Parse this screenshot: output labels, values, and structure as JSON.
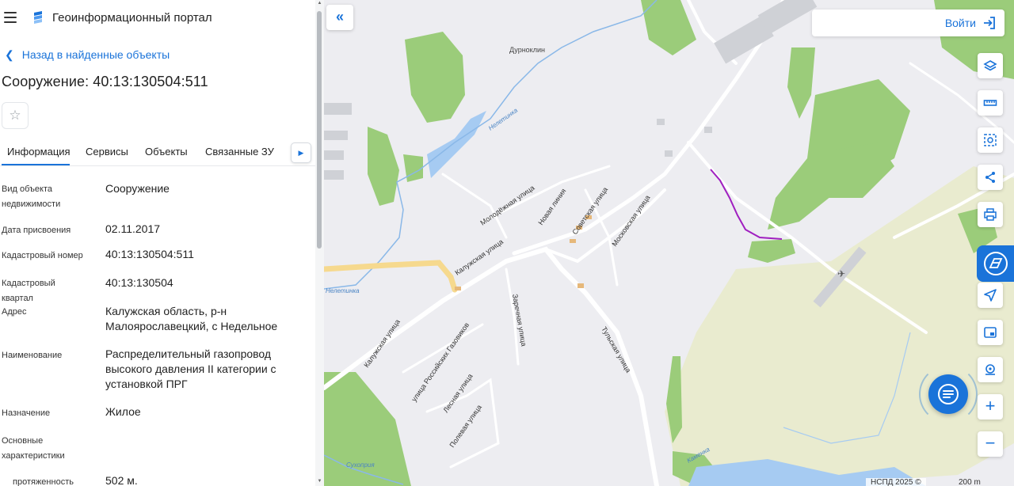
{
  "app": {
    "title": "Геоинформационный портал"
  },
  "nav": {
    "back_label": "Назад в найденные объекты"
  },
  "object": {
    "title": "Сооружение: 40:13:130504:511"
  },
  "tabs": [
    {
      "label": "Информация",
      "active": true
    },
    {
      "label": "Сервисы"
    },
    {
      "label": "Объекты"
    },
    {
      "label": "Связанные ЗУ"
    }
  ],
  "details": [
    {
      "label": "Вид объекта недвижимости",
      "value": "Сооружение"
    },
    {
      "label": "Дата присвоения",
      "value": "02.11.2017"
    },
    {
      "label": "Кадастровый номер",
      "value": "40:13:130504:511"
    },
    {
      "label": "Кадастровый квартал",
      "value": "40:13:130504"
    },
    {
      "label": "Адрес",
      "value": "Калужская область, р-н Малоярославецкий, с Недельное"
    },
    {
      "label": "Наименование",
      "value": "Распределительный газопровод высокого давления II категории с установкой ПРГ"
    },
    {
      "label": "Назначение",
      "value": "Жилое"
    },
    {
      "label": "Основные характеристики",
      "value": ""
    },
    {
      "label": "протяженность",
      "value": "502 м."
    }
  ],
  "map": {
    "login_label": "Войти",
    "place_labels": [
      "Дурноклин"
    ],
    "water_labels": [
      "Нелетинка",
      "Нелетинка",
      "Сухоприя",
      "Каменка"
    ],
    "street_labels": [
      "Молодёжная улица",
      "Новая линия",
      "Советская улица",
      "Московская улица",
      "Калужская улица",
      "Калужская улица",
      "Заречная улица",
      "Тульская улица",
      "улица Российских Газовиков",
      "Лесная улица",
      "Полевая улица"
    ],
    "attribution": "НСПД 2025 ©",
    "scale": "200 m",
    "accent_color": "#1a73d9",
    "object_line_color": "#a020c0"
  },
  "toolbar": [
    {
      "icon": "layers-icon"
    },
    {
      "icon": "ruler-icon"
    },
    {
      "icon": "select-area-icon"
    },
    {
      "icon": "share-icon"
    },
    {
      "icon": "print-icon"
    },
    {
      "icon": "active-tool-icon"
    },
    {
      "icon": "location-arrow-icon"
    },
    {
      "icon": "minimap-icon"
    },
    {
      "icon": "geo-search-icon"
    },
    {
      "icon": "zoom-in-icon",
      "label": "+"
    },
    {
      "icon": "zoom-out-icon",
      "label": "−"
    }
  ]
}
